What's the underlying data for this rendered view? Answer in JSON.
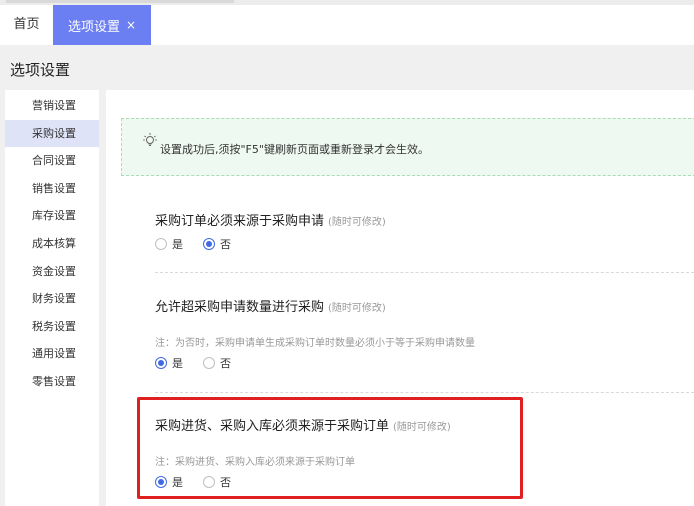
{
  "tabs": {
    "home_label": "首页",
    "active_label": "选项设置",
    "close_glyph": "×"
  },
  "page": {
    "title": "选项设置"
  },
  "sidebar": {
    "items": [
      {
        "label": "营销设置"
      },
      {
        "label": "采购设置"
      },
      {
        "label": "合同设置"
      },
      {
        "label": "销售设置"
      },
      {
        "label": "库存设置"
      },
      {
        "label": "成本核算"
      },
      {
        "label": "资金设置"
      },
      {
        "label": "财务设置"
      },
      {
        "label": "税务设置"
      },
      {
        "label": "通用设置"
      },
      {
        "label": "零售设置"
      }
    ],
    "active_index": 1
  },
  "notice": {
    "icon": "lightbulb-icon",
    "text": "设置成功后,须按\"F5\"键刷新页面或重新登录才会生效。"
  },
  "options": [
    {
      "title": "采购订单必须来源于采购申请",
      "hint": "(随时可修改)",
      "note": "",
      "yes_label": "是",
      "no_label": "否",
      "selected": "no"
    },
    {
      "title": "允许超采购申请数量进行采购",
      "hint": "(随时可修改)",
      "note": "注：为否时，采购申请单生成采购订单时数量必须小于等于采购申请数量",
      "yes_label": "是",
      "no_label": "否",
      "selected": "yes"
    },
    {
      "title": "采购进货、采购入库必须来源于采购订单",
      "hint": "(随时可修改)",
      "note": "注：采购进货、采购入库必须来源于采购订单",
      "yes_label": "是",
      "no_label": "否",
      "selected": "yes"
    }
  ],
  "colors": {
    "accent": "#6b7ef2",
    "radio_checked": "#4169e1",
    "highlight_box": "#e02020",
    "notice_bg": "#eef9f1"
  }
}
